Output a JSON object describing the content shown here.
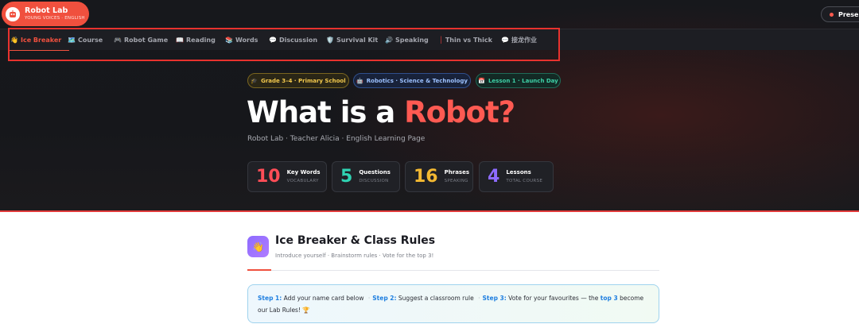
{
  "app": {
    "title": "Robot Lab",
    "subtitle": "YOUNG VOICES · ENGLISH"
  },
  "present_button": {
    "label": "Present"
  },
  "nav": [
    {
      "icon": "👋",
      "label": "Ice Breaker",
      "active": true
    },
    {
      "icon": "🗺️",
      "label": "Course"
    },
    {
      "icon": "🎮",
      "label": "Robot Game"
    },
    {
      "icon": "📖",
      "label": "Reading"
    },
    {
      "icon": "📚",
      "label": "Words"
    },
    {
      "icon": "💬",
      "label": "Discussion"
    },
    {
      "icon": "🛡️",
      "label": "Survival Kit"
    },
    {
      "icon": "🔊",
      "label": "Speaking"
    },
    {
      "icon": "│",
      "label": "Thin vs Thick"
    },
    {
      "icon": "💬",
      "label": "接龙作业"
    }
  ],
  "badges": [
    {
      "icon": "🎓",
      "label": "Grade 3–4 · Primary School"
    },
    {
      "icon": "🤖",
      "label": "Robotics · Science & Technology"
    },
    {
      "icon": "📅",
      "label": "Lesson 1 · Launch Day"
    }
  ],
  "hero": {
    "title_main": "What is a ",
    "title_accent": "Robot?",
    "subtitle": "Robot Lab · Teacher Alicia · English Learning Page"
  },
  "stats": [
    {
      "value": "10",
      "label": "Key Words",
      "sub": "VOCABULARY"
    },
    {
      "value": "5",
      "label": "Questions",
      "sub": "DISCUSSION"
    },
    {
      "value": "16",
      "label": "Phrases",
      "sub": "SPEAKING"
    },
    {
      "value": "4",
      "label": "Lessons",
      "sub": "TOTAL COURSE"
    }
  ],
  "section": {
    "icon": "👋",
    "title": "Ice Breaker & Class Rules",
    "description": "Introduce yourself · Brainstorm rules · Vote for the top 3!"
  },
  "steps": {
    "step1_label": "Step 1:",
    "step1_text": " Add your name card below ",
    "step2_label": "Step 2:",
    "step2_text": " Suggest a classroom rule ",
    "step3_label": "Step 3:",
    "step3_text": " Vote for your favourites — the ",
    "step3_em": "top 3",
    "step3_end": " become our Lab Rules! 🏆",
    "separator": "·"
  },
  "colors": {
    "accent": "#f0503e",
    "hero_bg": "#17181c",
    "nav_bg": "#1d1e23"
  }
}
